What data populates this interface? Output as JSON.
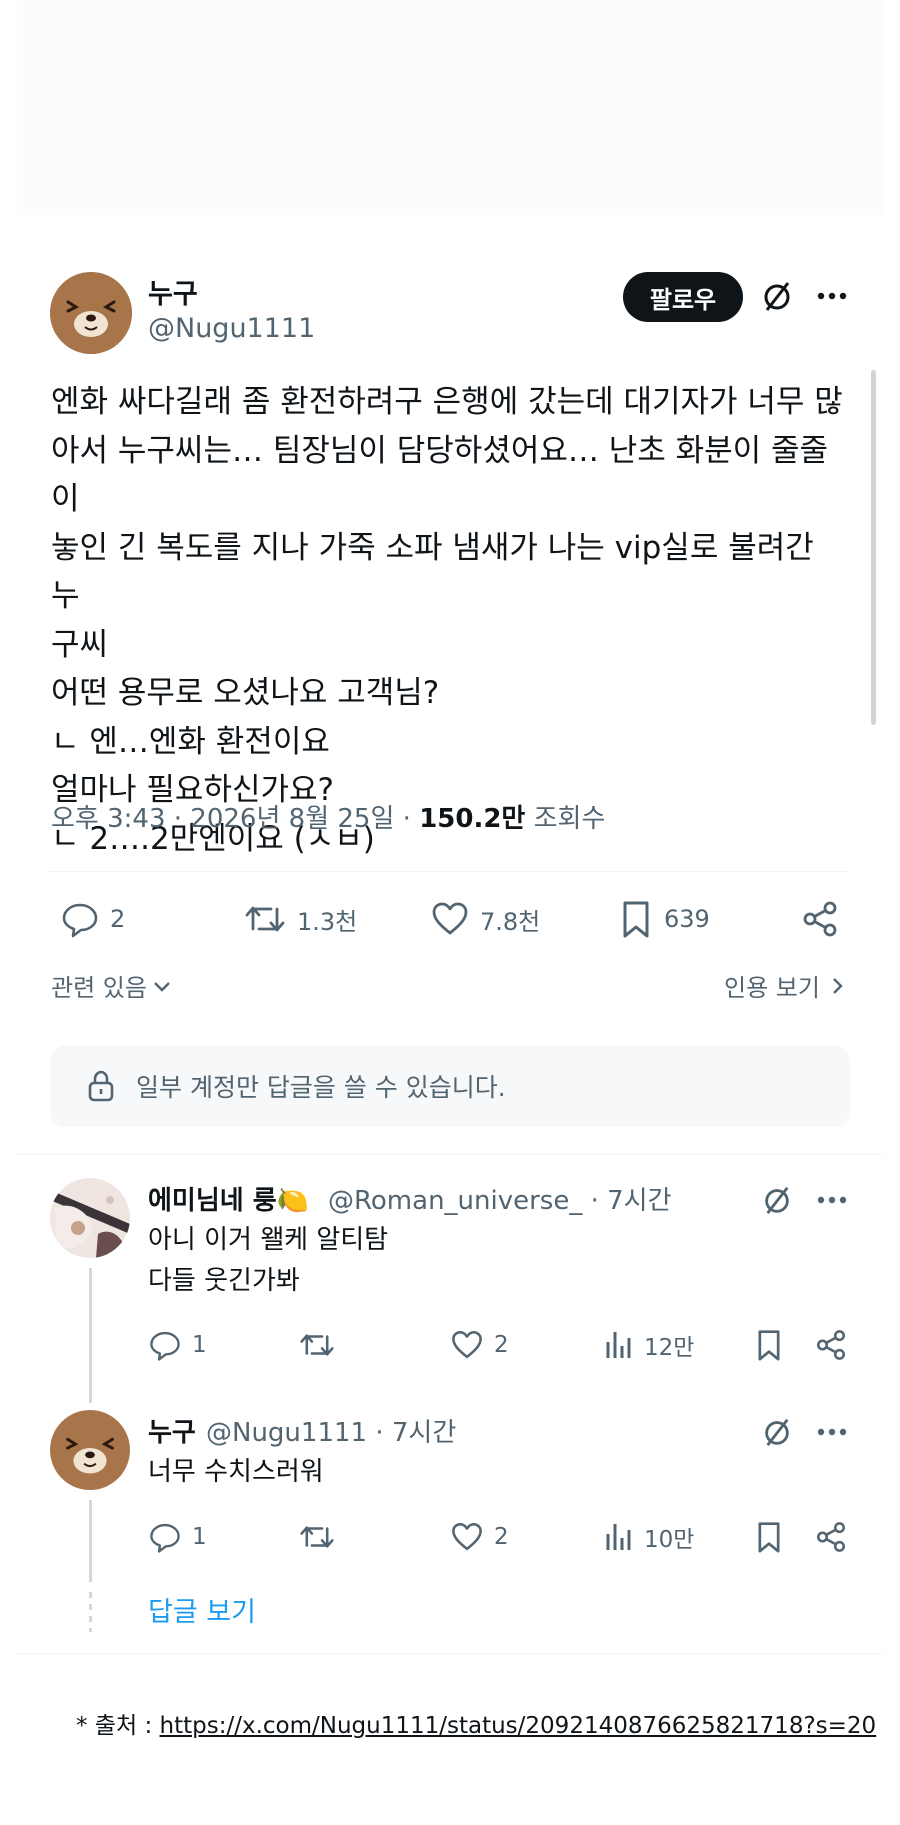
{
  "post": {
    "author_name": "누구",
    "author_handle": "@Nugu1111",
    "follow_label": "팔로우",
    "body": "엔화 싸다길래 좀 환전하려구 은행에 갔는데 대기자가 너무 많\n아서 누구씨는… 팀장님이 담당하셨어요… 난초 화분이 줄줄이\n놓인 긴 복도를 지나 가죽 소파 냄새가 나는 vip실로 불려간 누\n구씨\n어떤 용무로 오셨나요 고객님?\nㄴ 엔…엔화 환전이요\n얼마나 필요하신가요?\nㄴ 2….2만엔이요 (ㅅㅂ)",
    "time": "오후 3:43",
    "date": "2026년 8월 25일",
    "views_count": "150.2만",
    "views_label": "조회수",
    "sep": "·",
    "stats": {
      "replies": "2",
      "reposts": "1.3천",
      "likes": "7.8천",
      "bookmarks": "639"
    },
    "related_label": "관련 있음",
    "quotes_label": "인용 보기",
    "restriction_notice": "일부 계정만 답글을 쓸 수 있습니다."
  },
  "replies": [
    {
      "name": "에미님네 룽🍋",
      "handle": "@Roman_universe_",
      "time": "· 7시간",
      "text": "아니 이거 왤케 알티탐\n다들 웃긴가봐",
      "replies": "1",
      "likes": "2",
      "views": "12만"
    },
    {
      "name": "누구",
      "handle": "@Nugu1111",
      "time": "· 7시간",
      "text": "너무 수치스러워",
      "replies": "1",
      "likes": "2",
      "views": "10만"
    }
  ],
  "show_replies_label": "답글 보기",
  "source": {
    "prefix": "* 출처 :",
    "url": "https://x.com/Nugu1111/status/2092140876625821718?s=20"
  },
  "colors": {
    "text": "#0f1419",
    "secondary": "#536471",
    "link": "#1d9bf0",
    "follow_bg": "#0f1419"
  }
}
